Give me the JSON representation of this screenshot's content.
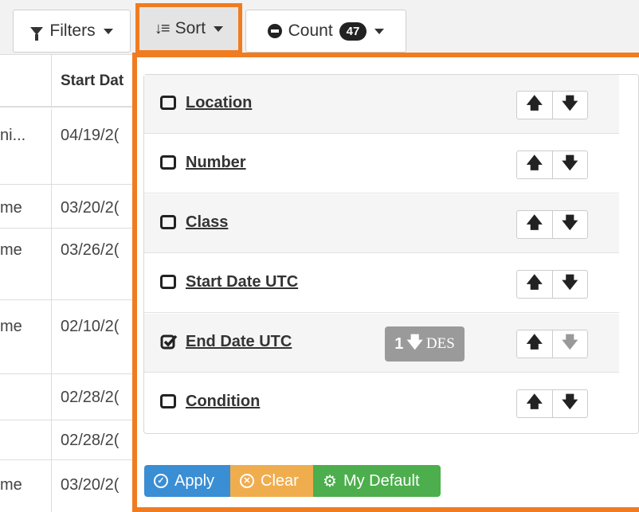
{
  "toolbar": {
    "filters_label": "Filters",
    "sort_label": "Sort",
    "count_label": "Count",
    "count_value": "47"
  },
  "table": {
    "header": "Start Dat",
    "rows": [
      {
        "c1": "ni...",
        "c2": "04/19/2("
      },
      {
        "c1": "me",
        "c2": "03/20/2("
      },
      {
        "c1": "me",
        "c2": "03/26/2("
      },
      {
        "c1": "me",
        "c2": "02/10/2("
      },
      {
        "c1": "",
        "c2": "02/28/2("
      },
      {
        "c1": "",
        "c2": "02/28/2("
      },
      {
        "c1": "me",
        "c2": "03/20/2("
      }
    ]
  },
  "sort_panel": {
    "fields": [
      {
        "label": "Location",
        "checked": false
      },
      {
        "label": "Number",
        "checked": false
      },
      {
        "label": "Class",
        "checked": false
      },
      {
        "label": "Start Date UTC",
        "checked": false
      },
      {
        "label": "End Date UTC",
        "checked": true,
        "order_index": "1",
        "order_dir": "DES"
      },
      {
        "label": "Condition",
        "checked": false
      }
    ],
    "apply_label": "Apply",
    "clear_label": "Clear",
    "default_label": "My Default"
  },
  "colors": {
    "highlight": "#f07c21",
    "apply": "#3a8ed4",
    "clear": "#f0ad4e",
    "default": "#4cae4c"
  }
}
